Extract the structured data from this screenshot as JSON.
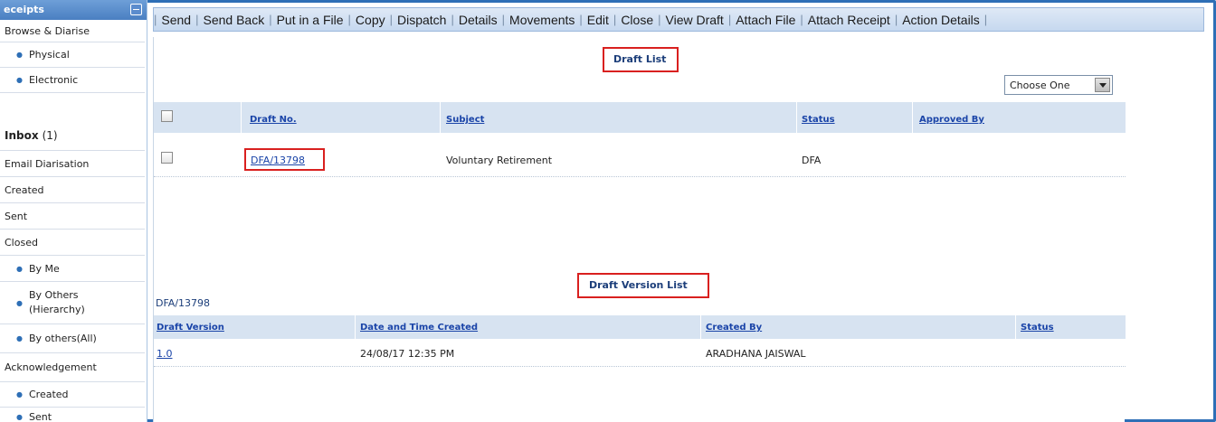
{
  "sidebar": {
    "header": "eceipts",
    "items": [
      {
        "label": "Browse & Diarise",
        "type": "top"
      },
      {
        "label": "Physical",
        "type": "sub"
      },
      {
        "label": "Electronic",
        "type": "sub"
      },
      {
        "label": "Inbox",
        "count": "(1)",
        "type": "top"
      },
      {
        "label": "Email Diarisation",
        "type": "top"
      },
      {
        "label": "Created",
        "type": "top"
      },
      {
        "label": "Sent",
        "type": "top"
      },
      {
        "label": "Closed",
        "type": "top"
      },
      {
        "label": "By Me",
        "type": "sub"
      },
      {
        "label": "By Others",
        "label2": "(Hierarchy)",
        "type": "sub"
      },
      {
        "label": "By others(All)",
        "type": "sub"
      },
      {
        "label": "Acknowledgement",
        "type": "top"
      },
      {
        "label": "Created",
        "type": "sub"
      },
      {
        "label": "Sent",
        "type": "sub"
      }
    ]
  },
  "toolbar": {
    "items": [
      "Send",
      "Send Back",
      "Put in a File",
      "Copy",
      "Dispatch",
      "Details",
      "Movements",
      "Edit",
      "Close",
      "View Draft",
      "Attach File",
      "Attach Receipt",
      "Action Details"
    ]
  },
  "draft_list": {
    "title": "Draft List",
    "choose": "Choose One",
    "columns": [
      "Draft No.",
      "Subject",
      "Status",
      "Approved By"
    ],
    "rows": [
      {
        "draft_no": "DFA/13798",
        "subject": "Voluntary Retirement",
        "status": "DFA",
        "approved_by": ""
      }
    ]
  },
  "draft_version_list": {
    "title": "Draft Version List",
    "draft_ref": "DFA/13798",
    "columns": [
      "Draft Version",
      "Date and Time Created",
      "Created By",
      "Status"
    ],
    "rows": [
      {
        "version": "1.0",
        "created": "24/08/17 12:35 PM",
        "created_by": "ARADHANA JAISWAL",
        "status": ""
      }
    ]
  },
  "colors": {
    "frame": "#2e6fb6",
    "header_gradient_top": "#6e9fd8",
    "grid_header": "#d7e3f1",
    "link": "#1a44a8",
    "highlight_box": "#d9201f"
  }
}
